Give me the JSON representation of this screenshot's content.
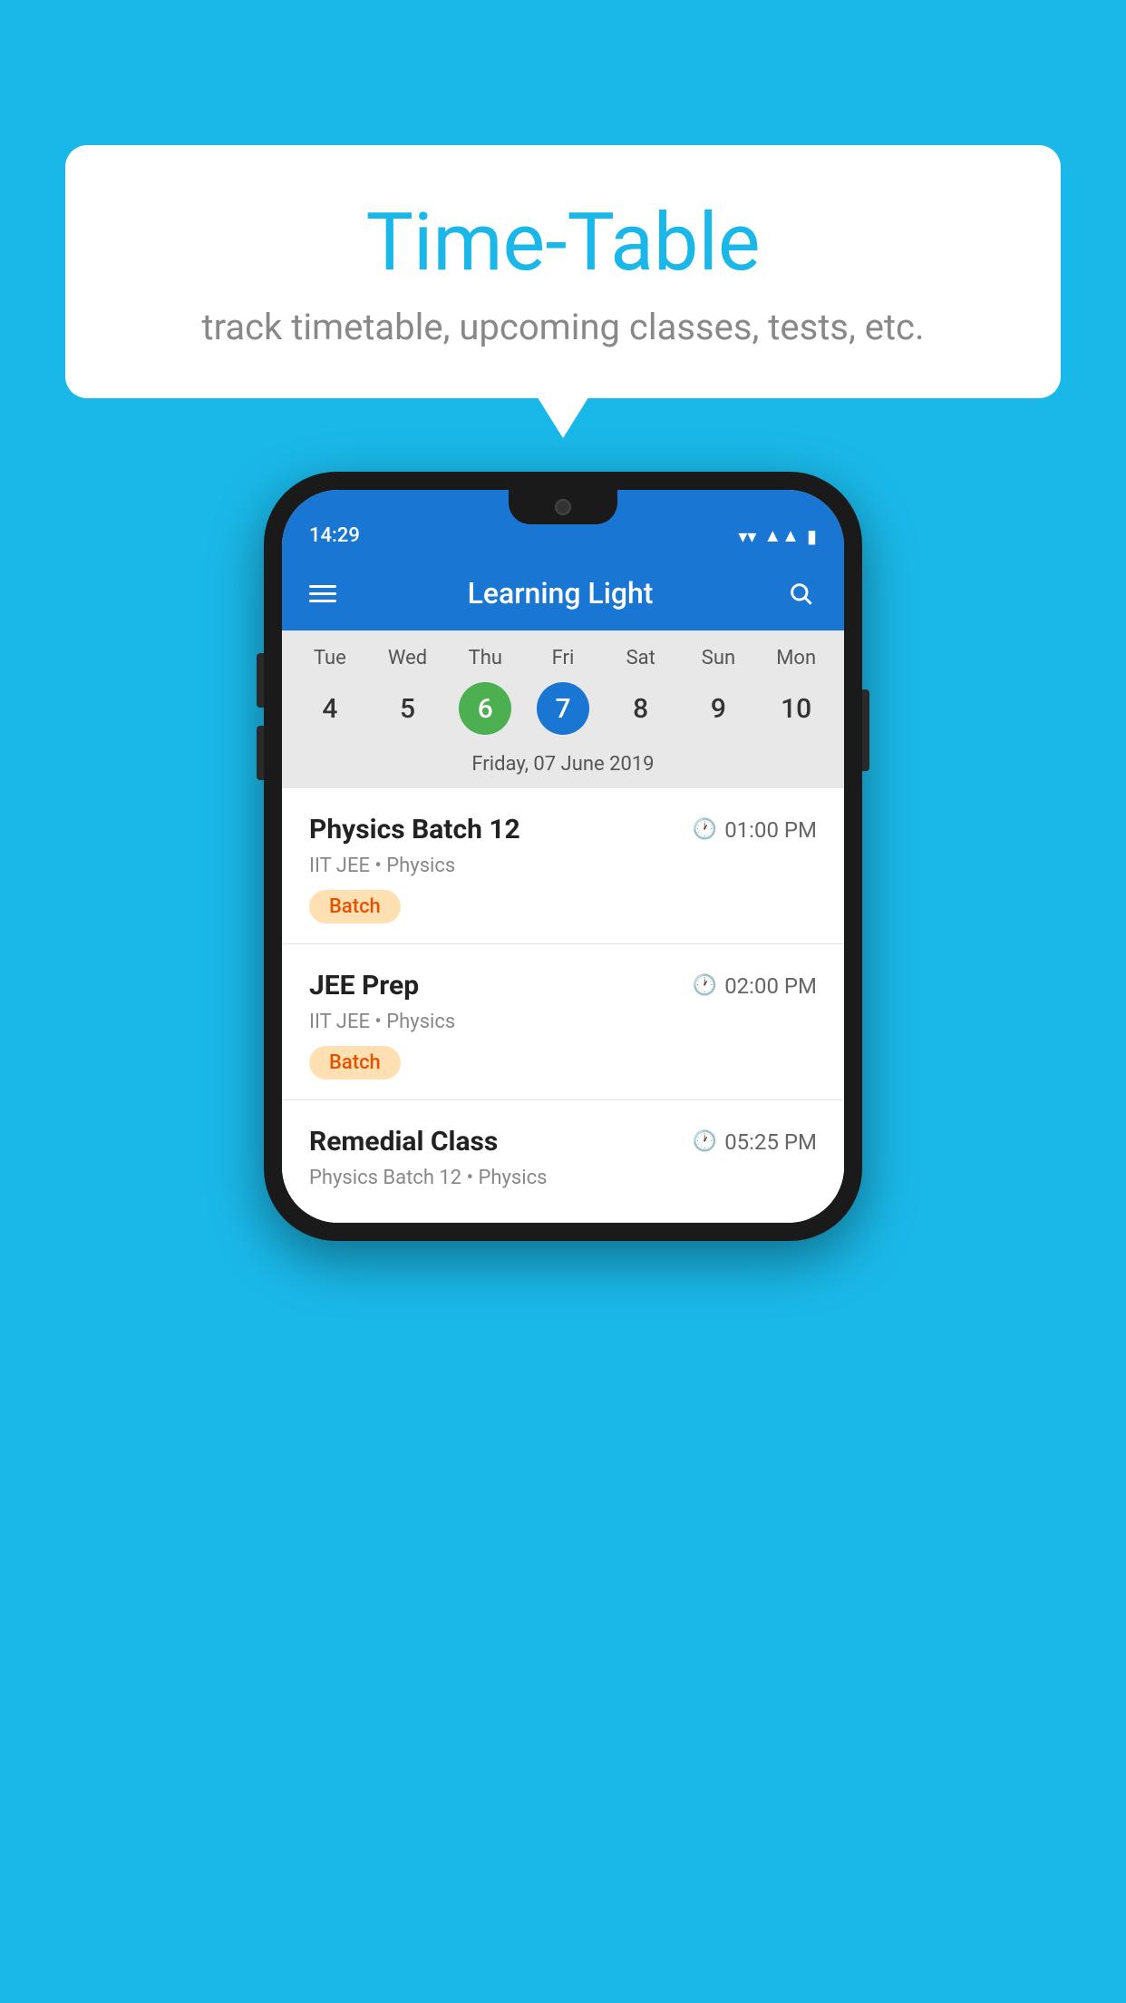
{
  "background_color": "#1ab8e8",
  "bubble": {
    "title": "Time-Table",
    "subtitle": "track timetable, upcoming classes, tests, etc."
  },
  "phone": {
    "status_bar": {
      "time": "14:29"
    },
    "app_bar": {
      "title": "Learning Light"
    },
    "calendar": {
      "days": [
        {
          "name": "Tue",
          "num": "4",
          "state": "normal"
        },
        {
          "name": "Wed",
          "num": "5",
          "state": "normal"
        },
        {
          "name": "Thu",
          "num": "6",
          "state": "today"
        },
        {
          "name": "Fri",
          "num": "7",
          "state": "selected"
        },
        {
          "name": "Sat",
          "num": "8",
          "state": "normal"
        },
        {
          "name": "Sun",
          "num": "9",
          "state": "normal"
        },
        {
          "name": "Mon",
          "num": "10",
          "state": "normal"
        }
      ],
      "selected_date_label": "Friday, 07 June 2019"
    },
    "schedule": [
      {
        "name": "Physics Batch 12",
        "time": "01:00 PM",
        "meta": "IIT JEE • Physics",
        "badge": "Batch"
      },
      {
        "name": "JEE Prep",
        "time": "02:00 PM",
        "meta": "IIT JEE • Physics",
        "badge": "Batch"
      },
      {
        "name": "Remedial Class",
        "time": "05:25 PM",
        "meta": "Physics Batch 12 • Physics",
        "badge": null
      }
    ]
  }
}
